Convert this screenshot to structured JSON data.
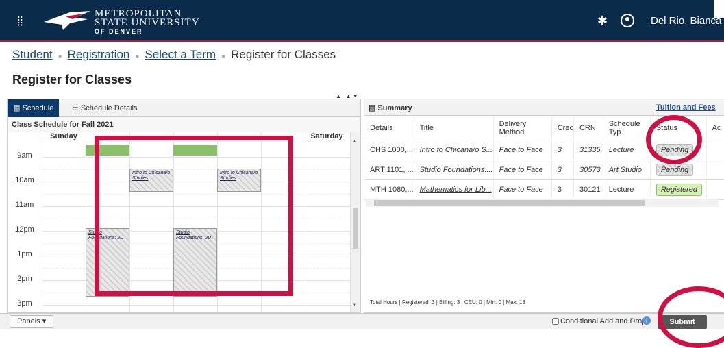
{
  "header": {
    "logo_line1": "METROPOLITAN",
    "logo_line2": "STATE UNIVERSITY",
    "logo_line3": "OF DENVER",
    "username": "Del Rio, Bianca"
  },
  "breadcrumb": [
    "Student",
    "Registration",
    "Select a Term",
    "Register for Classes"
  ],
  "page_title": "Register for Classes",
  "left_panel": {
    "tab_schedule": "Schedule",
    "tab_details": "Schedule Details",
    "schedule_title": "Class Schedule for Fall 2021",
    "days": [
      "Sunday",
      "",
      "",
      "",
      "",
      "",
      "Saturday"
    ],
    "hours": [
      "9am",
      "10am",
      "11am",
      "12pm",
      "1pm",
      "2pm",
      "3pm"
    ],
    "events": [
      {
        "label": "Intro to Chicana/o Studies"
      },
      {
        "label": "Intro to Chicana/o Studies"
      },
      {
        "label": "Studio Foundations: 2D"
      },
      {
        "label": "Studio Foundations: 2D"
      }
    ]
  },
  "summary": {
    "title": "Summary",
    "tuition_link": "Tuition and Fees",
    "columns": [
      "Details",
      "Title",
      "Delivery Method",
      "Crec",
      "CRN",
      "Schedule Typ",
      "Status",
      "Ac"
    ],
    "rows": [
      {
        "details": "CHS 1000,...",
        "title": "Intro to Chicana/o S...",
        "delivery": "Face to Face",
        "credits": "3",
        "crn": "31335",
        "schedule": "Lecture",
        "status": "Pending"
      },
      {
        "details": "ART 1101, ...",
        "title": "Studio Foundations:...",
        "delivery": "Face to Face",
        "credits": "3",
        "crn": "30573",
        "schedule": "Art Studio",
        "status": "Pending"
      },
      {
        "details": "MTH 1080,...",
        "title": "Mathematics for Lib...",
        "delivery": "Face to Face",
        "credits": "3",
        "crn": "30121",
        "schedule": "Lecture",
        "status": "Registered"
      }
    ],
    "totals": "Total Hours | Registered: 3 | Billing: 3 | CEU: 0 | Min: 0 | Max: 18"
  },
  "bottom": {
    "panels_label": "Panels",
    "conditional_label": "Conditional Add and Drop",
    "submit_label": "Submit"
  },
  "colors": {
    "header": "#0b2b4b",
    "accent_red": "#c8102e",
    "annotation": "#cc1144",
    "registered": "#8bc06b"
  }
}
